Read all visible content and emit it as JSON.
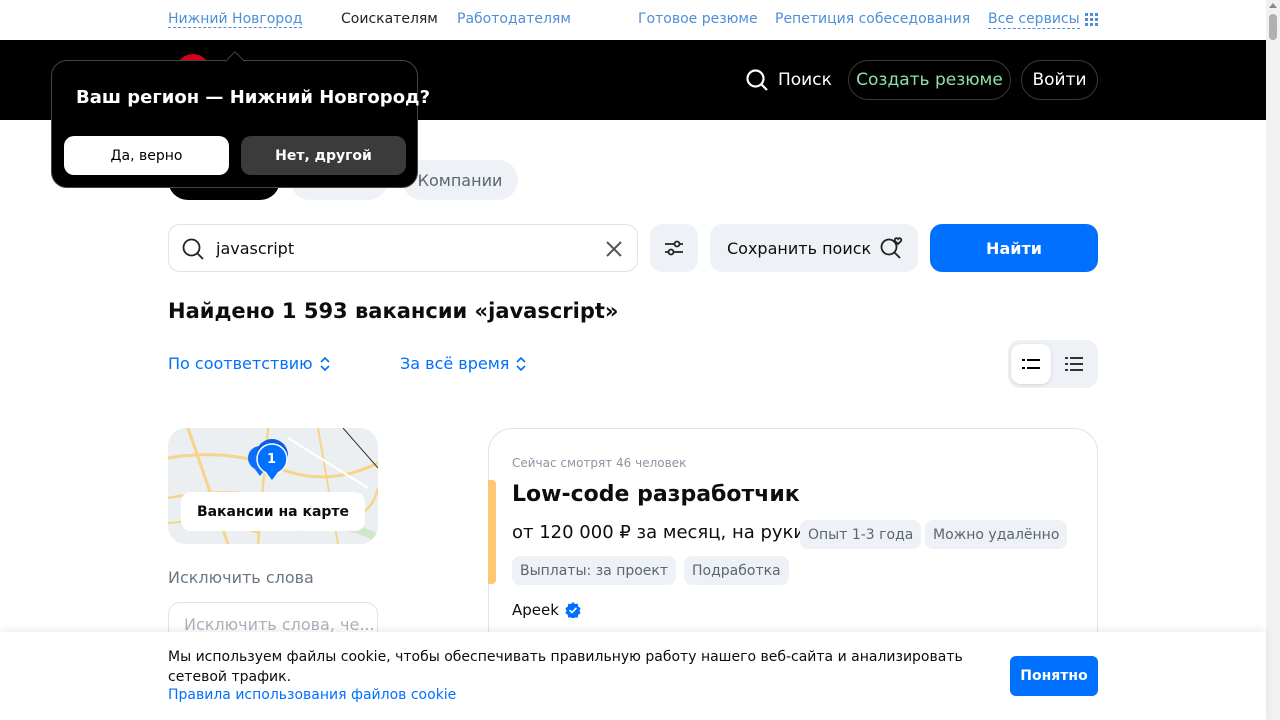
{
  "topbar": {
    "region": "Нижний Новгород",
    "seekers": "Соискателям",
    "employers": "Работодателям",
    "ready_resume": "Готовое резюме",
    "interview_rehearsal": "Репетиция собеседования",
    "all_services": "Все сервисы"
  },
  "header": {
    "search": "Поиск",
    "create_resume": "Создать резюме",
    "login": "Войти"
  },
  "region_popup": {
    "title": "Ваш регион — Нижний Новгород?",
    "yes": "Да, верно",
    "no": "Нет, другой"
  },
  "tabs": {
    "companies": "Компании"
  },
  "search": {
    "query": "javascript",
    "save_search": "Сохранить поиск",
    "find": "Найти"
  },
  "results": {
    "found_text": "Найдено 1 593 вакансии «javascript»",
    "sort_relevance": "По соответствию",
    "sort_period": "За всё время"
  },
  "sidebar": {
    "map_count": "1",
    "map_button": "Вакансии на карте",
    "exclude_label": "Исключить слова",
    "exclude_placeholder": "Исключить слова, че..."
  },
  "vacancy": {
    "viewers": "Сейчас смотрят 46 человек",
    "title": "Low-code разработчик",
    "salary": "от 120 000 ₽ за месяц, на руки",
    "experience": "Опыт 1-3 года",
    "remote": "Можно удалённо",
    "payments": "Выплаты: за проект",
    "parttime": "Подработка",
    "company": "Apeek",
    "accent_color": "#ffc773"
  },
  "cookie": {
    "text": "Мы используем файлы cookie, чтобы обеспечивать правильную работу нашего веб-сайта и анализировать сетевой трафик.",
    "link": "Правила использования файлов cookie",
    "ok": "Понятно"
  },
  "colors": {
    "accent_blue": "#0070ff",
    "header_bg": "#000000",
    "create_resume_text": "#8fe0a8",
    "brand_red": "#d6001c"
  }
}
